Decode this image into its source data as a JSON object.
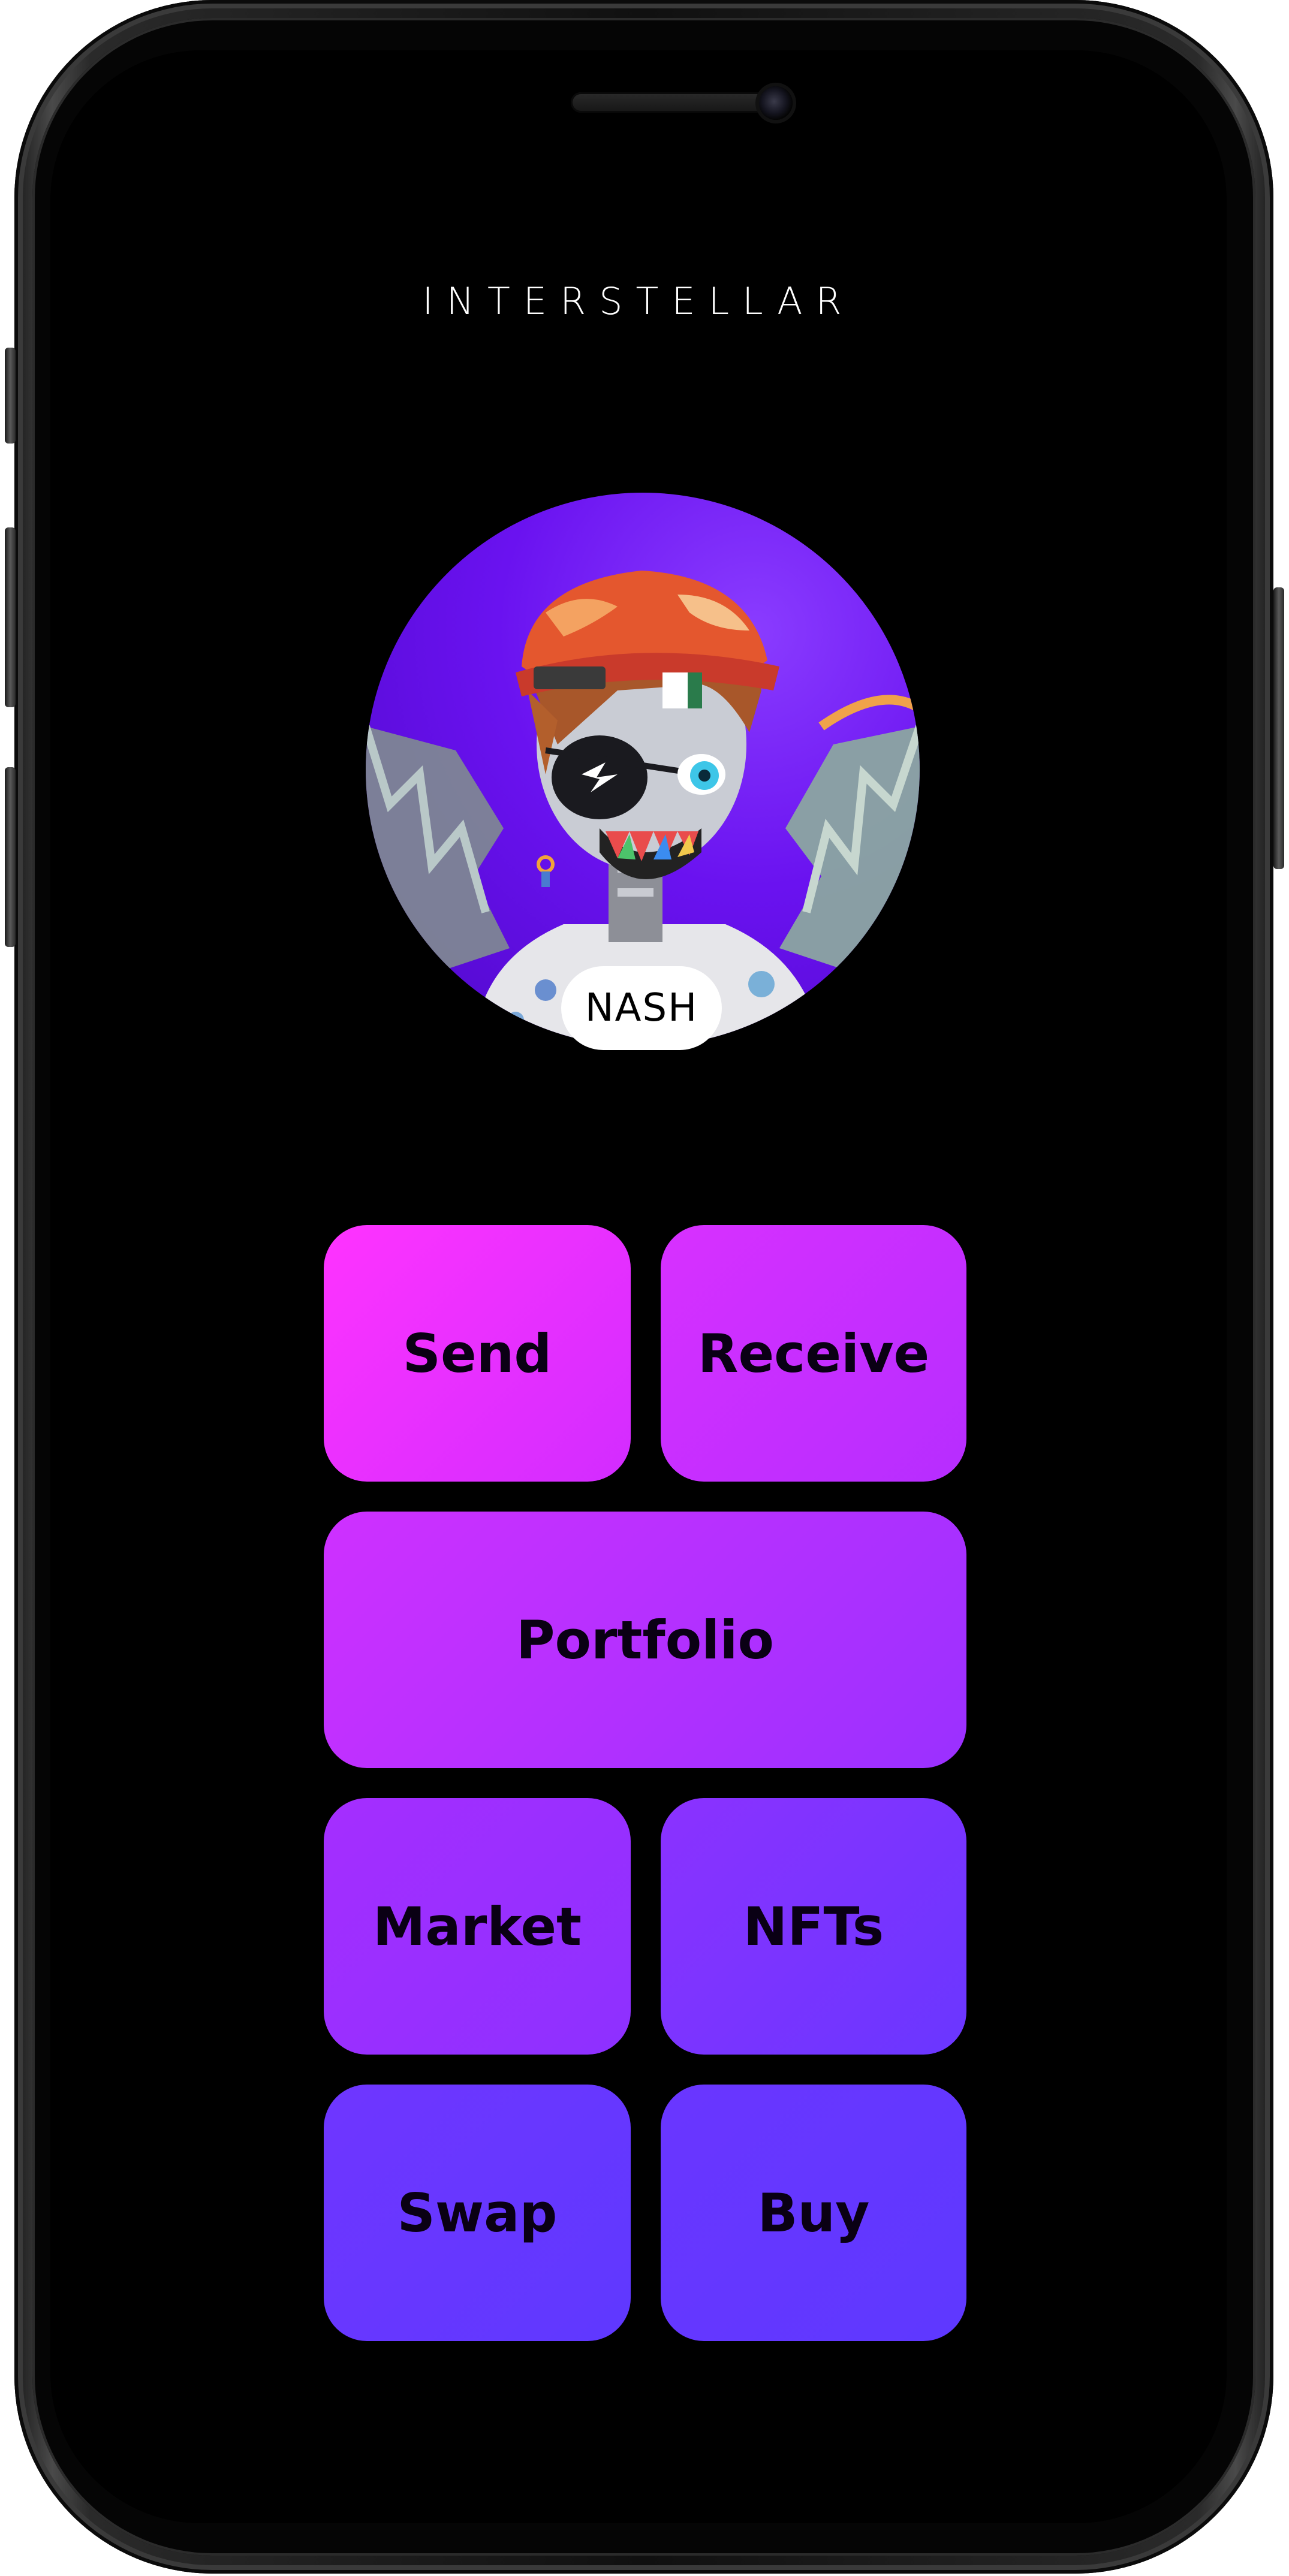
{
  "app": {
    "brand": "INTERSTELLAR"
  },
  "profile": {
    "name": "NASH",
    "avatar_icon": "nft-avatar-robot-with-cap-and-wings"
  },
  "actions": {
    "send": "Send",
    "receive": "Receive",
    "portfolio": "Portfolio",
    "market": "Market",
    "nfts": "NFTs",
    "swap": "Swap",
    "buy": "Buy"
  },
  "colors": {
    "screen_background": "#000000",
    "gradient_start": "#ff33ff",
    "gradient_end": "#5e38ff",
    "avatar_background": "#6a12f0"
  }
}
